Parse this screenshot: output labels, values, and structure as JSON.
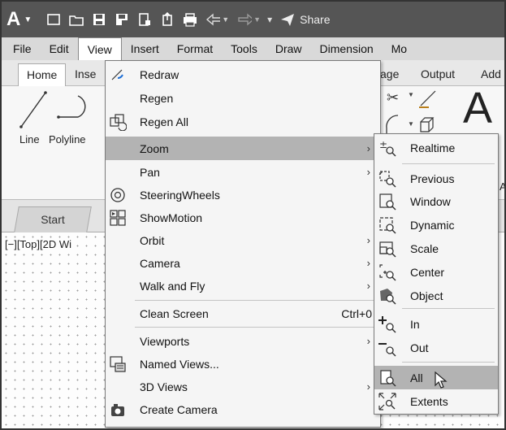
{
  "qat": {
    "logo": "A",
    "share_label": "Share"
  },
  "menubar": {
    "items": [
      "File",
      "Edit",
      "View",
      "Insert",
      "Format",
      "Tools",
      "Draw",
      "Dimension",
      "Mo"
    ]
  },
  "ribbon": {
    "tabs": [
      "Home",
      "Inse",
      "age",
      "Output",
      "Add"
    ],
    "tools": [
      "Line",
      "Polyline"
    ],
    "big_text_glyph": "A",
    "cut_label": "A"
  },
  "filetabs": {
    "start": "Start"
  },
  "drawing": {
    "viewport_label": "[−][Top][2D Wi"
  },
  "view_menu": {
    "items": [
      {
        "label": "Redraw",
        "icon": "redraw-icon"
      },
      {
        "label": "Regen",
        "icon": ""
      },
      {
        "label": "Regen All",
        "icon": "regen-all-icon"
      },
      {
        "label": "Zoom",
        "arrow": "›",
        "highlighted": true
      },
      {
        "label": "Pan",
        "arrow": "›"
      },
      {
        "label": "SteeringWheels",
        "icon": "steering-wheels-icon"
      },
      {
        "label": "ShowMotion",
        "icon": "showmotion-icon"
      },
      {
        "label": "Orbit",
        "arrow": "›"
      },
      {
        "label": "Camera",
        "arrow": "›"
      },
      {
        "label": "Walk and Fly",
        "arrow": "›"
      },
      {
        "label": "Clean Screen",
        "shortcut": "Ctrl+0"
      },
      {
        "label": "Viewports",
        "arrow": "›"
      },
      {
        "label": "Named Views...",
        "icon": "named-views-icon"
      },
      {
        "label": "3D Views",
        "arrow": "›"
      },
      {
        "label": "Create Camera",
        "icon": "camera-icon"
      }
    ]
  },
  "zoom_submenu": {
    "items": [
      {
        "label": "Realtime",
        "icon": "zoom-realtime-icon"
      },
      {
        "label": "Previous",
        "icon": "zoom-previous-icon"
      },
      {
        "label": "Window",
        "icon": "zoom-window-icon"
      },
      {
        "label": "Dynamic",
        "icon": "zoom-dynamic-icon"
      },
      {
        "label": "Scale",
        "icon": "zoom-scale-icon"
      },
      {
        "label": "Center",
        "icon": "zoom-center-icon"
      },
      {
        "label": "Object",
        "icon": "zoom-object-icon"
      },
      {
        "label": "In",
        "icon": "zoom-in-icon"
      },
      {
        "label": "Out",
        "icon": "zoom-out-icon"
      },
      {
        "label": "All",
        "icon": "zoom-all-icon",
        "highlighted": true
      },
      {
        "label": "Extents",
        "icon": "zoom-extents-icon"
      }
    ]
  },
  "colors": {
    "titlebar": "#555555",
    "menubar": "#d9d9d9",
    "highlight": "#b3b3b3",
    "menu_bg": "#f5f5f5"
  }
}
